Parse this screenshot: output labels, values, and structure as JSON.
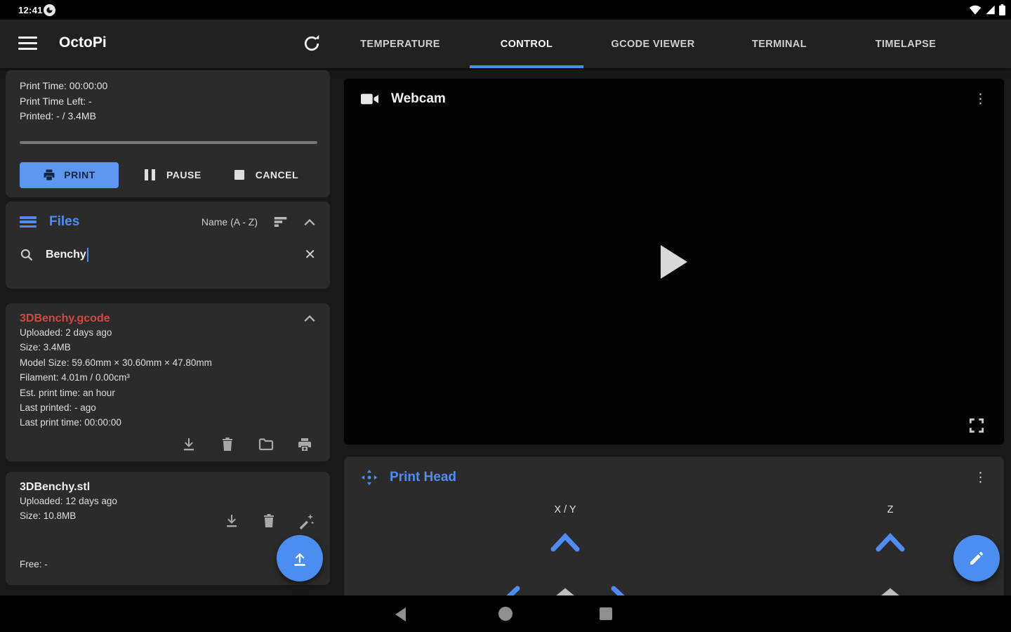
{
  "colors": {
    "accent_blue": "#4f8df5",
    "button_blue": "#5d97f0",
    "fab_blue": "#4b8ef0",
    "file_red": "#cf4a42",
    "card_bg": "#2b2b2b",
    "page_bg": "#191919"
  },
  "status_bar": {
    "time": "12:41"
  },
  "app_bar": {
    "title": "OctoPi",
    "tabs": [
      {
        "label": "TEMPERATURE",
        "active": false
      },
      {
        "label": "CONTROL",
        "active": true
      },
      {
        "label": "GCODE VIEWER",
        "active": false
      },
      {
        "label": "TERMINAL",
        "active": false
      },
      {
        "label": "TIMELAPSE",
        "active": false
      }
    ]
  },
  "print_panel": {
    "print_time": "Print Time: 00:00:00",
    "print_time_left": "Print Time Left: -",
    "printed": "Printed: - / 3.4MB",
    "print_label": "PRINT",
    "pause_label": "PAUSE",
    "cancel_label": "CANCEL"
  },
  "files_panel": {
    "title": "Files",
    "sort_label": "Name (A - Z)",
    "search_value": "Benchy",
    "clear_glyph": "✕"
  },
  "gcode_file": {
    "name": "3DBenchy.gcode",
    "details": [
      "Uploaded: 2 days ago",
      "Size: 3.4MB",
      "Model Size: 59.60mm × 30.60mm × 47.80mm",
      "Filament: 4.01m / 0.00cm³",
      "Est. print time: an hour",
      "Last printed: - ago",
      "Last print time: 00:00:00"
    ]
  },
  "stl_file": {
    "name": "3DBenchy.stl",
    "uploaded": "Uploaded: 12 days ago",
    "size": "Size: 10.8MB",
    "free": "Free: -"
  },
  "webcam": {
    "title": "Webcam",
    "menu_glyph": "⋮"
  },
  "print_head": {
    "title": "Print Head",
    "xy_label": "X / Y",
    "z_label": "Z",
    "menu_glyph": "⋮"
  }
}
